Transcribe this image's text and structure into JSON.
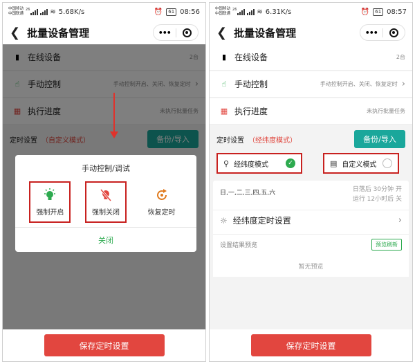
{
  "screens": [
    {
      "status": {
        "carrier1": "中国移动",
        "carrier2": "中国联通",
        "hd": "26",
        "speed": "5.68K/s",
        "battery": "61",
        "time": "08:56"
      },
      "nav": {
        "title": "批量设备管理"
      },
      "menu": [
        {
          "label": "在线设备",
          "value": "2台",
          "icon": "phone-icon"
        },
        {
          "label": "手动控制",
          "value": "手动控制开启、关闭、恢复定时",
          "icon": "hand-icon"
        },
        {
          "label": "执行进度",
          "value": "未执行批量任务",
          "icon": "grid-icon"
        }
      ],
      "schedule": {
        "label": "定时设置",
        "mode": "（自定义模式）",
        "button": "备份/导入"
      },
      "save": "保存定时设置",
      "dialog": {
        "title": "手动控制/调试",
        "options": [
          {
            "label": "强制开启",
            "icon": "bulb-on-icon"
          },
          {
            "label": "强制关闭",
            "icon": "bulb-off-icon"
          },
          {
            "label": "恢复定时",
            "icon": "restore-icon"
          }
        ],
        "close": "关闭"
      }
    },
    {
      "status": {
        "carrier1": "中国移动",
        "carrier2": "中国联通",
        "hd": "26",
        "speed": "6.31K/s",
        "battery": "61",
        "time": "08:57"
      },
      "nav": {
        "title": "批量设备管理"
      },
      "menu": [
        {
          "label": "在线设备",
          "value": "2台",
          "icon": "phone-icon"
        },
        {
          "label": "手动控制",
          "value": "手动控制开启、关闭、恢复定时",
          "icon": "hand-icon"
        },
        {
          "label": "执行进度",
          "value": "未执行批量任务",
          "icon": "grid-icon"
        }
      ],
      "schedule": {
        "label": "定时设置",
        "mode": "（经纬度模式）",
        "button": "备份/导入"
      },
      "modes": [
        {
          "label": "经纬度模式",
          "selected": true,
          "icon": "location-pin-icon"
        },
        {
          "label": "自定义模式",
          "selected": false,
          "icon": "calendar-icon"
        }
      ],
      "latlng": {
        "days": "日,一,二,三,四,五,六",
        "line1": "日落后 30分钟 开",
        "line2": "运行 12小时后 关",
        "settings": "经纬度定时设置"
      },
      "preview": {
        "label": "设置结果预览",
        "refresh": "预览刷新",
        "empty": "暂无预览"
      },
      "save": "保存定时设置"
    }
  ],
  "colors": {
    "teal": "#1aa79b",
    "red": "#e2463f",
    "green": "#2daa4f",
    "highlight": "#c8211f"
  }
}
